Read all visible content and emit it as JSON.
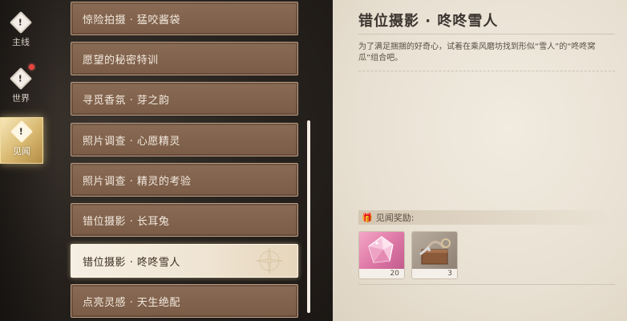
{
  "nav": [
    {
      "label": "主线",
      "icon": "exclamation-diamond-icon"
    },
    {
      "label": "世界",
      "icon": "exclamation-diamond-icon"
    },
    {
      "label": "见闻",
      "icon": "exclamation-diamond-icon",
      "active": true
    }
  ],
  "tasks": [
    {
      "label": "惊险拍摄 · 猛咬酱袋"
    },
    {
      "label": "愿望的秘密特训"
    },
    {
      "label": "寻觅香氛 · 芽之韵"
    },
    {
      "label": "照片调查 · 心愿精灵"
    },
    {
      "label": "照片调查 · 精灵的考验"
    },
    {
      "label": "错位摄影 · 长耳兔"
    },
    {
      "label": "错位摄影 · 咚咚雪人",
      "selected": true
    },
    {
      "label": "点亮灵感 · 天生绝配"
    }
  ],
  "detail": {
    "title": "错位摄影 · 咚咚雪人",
    "description": "为了满足捆捆的好奇心，试着在乘风磨坊找到形似“雪人”的“咚咚窝瓜”组合吧。",
    "reward_header": "见闻奖励:",
    "rewards": [
      {
        "name": "pink-crystal",
        "count": "20"
      },
      {
        "name": "tool-crate",
        "count": "3"
      }
    ]
  },
  "colors": {
    "accent_gold": "#d8b870",
    "task_bg": "#7a5c47",
    "panel_bg": "#efe8dc",
    "badge_red": "#e8463f"
  }
}
